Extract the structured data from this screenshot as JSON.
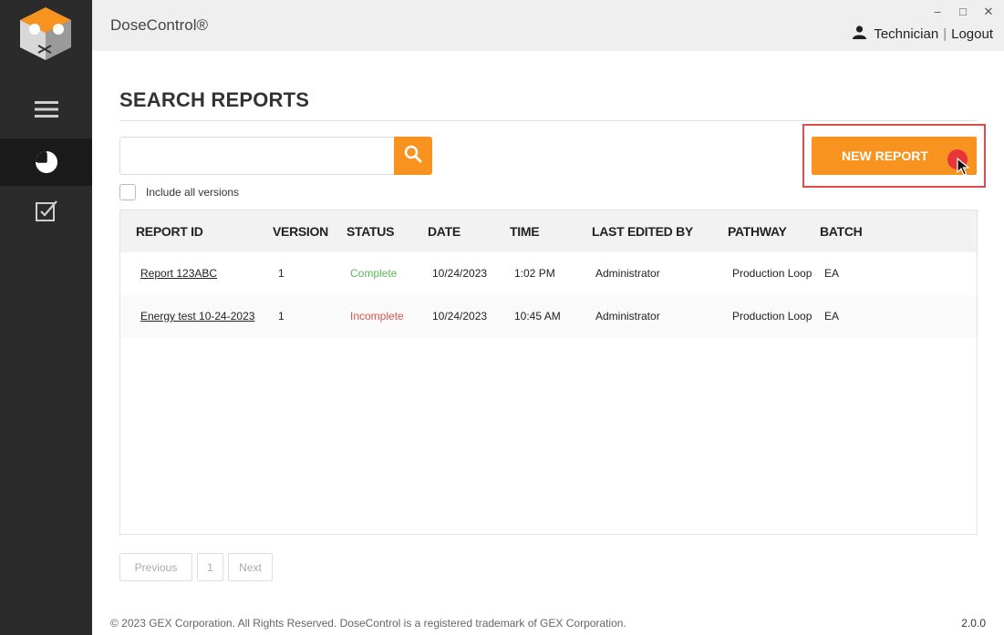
{
  "app": {
    "title": "DoseControl®"
  },
  "window_controls": {
    "minimize": "‒",
    "maximize": "□",
    "close": "✕"
  },
  "user": {
    "name": "Technician",
    "separator": "|",
    "logout": "Logout"
  },
  "sidebar": {
    "items": [
      {
        "icon": "hamburger-menu-icon"
      },
      {
        "icon": "pie-chart-icon",
        "active": true
      },
      {
        "icon": "checkbox-icon"
      }
    ]
  },
  "page": {
    "title": "SEARCH REPORTS"
  },
  "search": {
    "placeholder": "",
    "value": ""
  },
  "include_versions": {
    "label": "Include all versions",
    "checked": false
  },
  "new_report": {
    "label": "NEW REPORT"
  },
  "table": {
    "headers": [
      "REPORT ID",
      "VERSION",
      "STATUS",
      "DATE",
      "TIME",
      "LAST EDITED BY",
      "PATHWAY",
      "BATCH"
    ],
    "rows": [
      {
        "report_id": "Report 123ABC",
        "version": "1",
        "status": "Complete",
        "date": "10/24/2023",
        "time": "1:02 PM",
        "last_edited_by": "Administrator",
        "pathway": "Production Loop",
        "batch": "EA"
      },
      {
        "report_id": "Energy test 10-24-2023",
        "version": "1",
        "status": "Incomplete",
        "date": "10/24/2023",
        "time": "10:45 AM",
        "last_edited_by": "Administrator",
        "pathway": "Production Loop",
        "batch": "EA"
      }
    ]
  },
  "status_colors": {
    "Complete": "#5cb85c",
    "Incomplete": "#d9534f"
  },
  "accent_color": "#f7931e",
  "pagination": {
    "previous": "Previous",
    "page": "1",
    "next": "Next"
  },
  "footer": {
    "copyright": "© 2023 GEX Corporation. All Rights Reserved. DoseControl is a registered trademark of GEX Corporation.",
    "version": "2.0.0"
  }
}
